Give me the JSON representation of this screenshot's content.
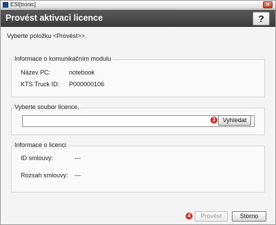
{
  "window": {
    "title": "ESI[tronic]"
  },
  "header": {
    "title": "Provést aktivaci licence",
    "help_label": "?"
  },
  "instruction": "Vyberte položku <Provést>>.",
  "module_panel": {
    "legend": "Informace o komunikačním modulu",
    "pc_name_label": "Název PC:",
    "pc_name_value": "notebook",
    "kts_label": "KTS Truck ID:",
    "kts_value": "P000000106"
  },
  "file_panel": {
    "legend": "Vyberte soubor licence.",
    "file_value": "",
    "browse_label": "Vyhledat",
    "browse_marker": "3"
  },
  "license_panel": {
    "legend": "Informace o licenci",
    "contract_id_label": "ID smlouvy:",
    "contract_id_value": "---",
    "contract_scope_label": "Rozsah smlouvy:",
    "contract_scope_value": "---"
  },
  "footer": {
    "run_label": "Provést",
    "run_marker": "4",
    "cancel_label": "Storno"
  },
  "colors": {
    "header_bg": "#4a4a4a",
    "marker": "#d8261c",
    "close_button": "#c23b24"
  },
  "icons": {
    "app": "esitronic-app-icon",
    "close": "close-icon",
    "help": "help-icon"
  }
}
